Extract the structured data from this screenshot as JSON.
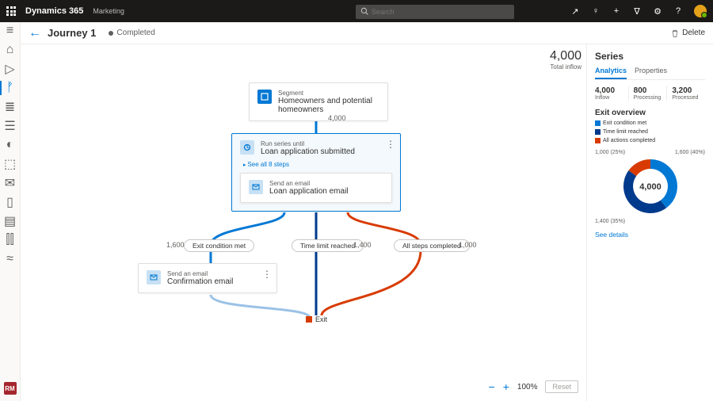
{
  "header": {
    "brand": "Dynamics 365",
    "app": "Marketing",
    "search_placeholder": "Search"
  },
  "cmdbar": {
    "title": "Journey 1",
    "status": "Completed",
    "delete": "Delete"
  },
  "canvas": {
    "total_inflow": "4,000",
    "total_inflow_label": "Total inflow",
    "segment": {
      "sub": "Segment",
      "main": "Homeowners and potential homeowners"
    },
    "count_after_segment": "4,000",
    "series": {
      "sub": "Run series until",
      "main": "Loan application submitted",
      "see_all": "See all 8 steps",
      "child": {
        "sub": "Send an email",
        "main": "Loan application email"
      }
    },
    "branches": {
      "left": {
        "label": "Exit condition met",
        "count": "1,600"
      },
      "mid": {
        "label": "Time limit reached",
        "count": "1,400"
      },
      "right": {
        "label": "All steps completed",
        "count": "1,000"
      }
    },
    "confirm": {
      "sub": "Send an email",
      "main": "Confirmation email"
    },
    "exit": "Exit",
    "zoom": "100%",
    "reset": "Reset"
  },
  "panel": {
    "title": "Series",
    "tabs": {
      "analytics": "Analytics",
      "properties": "Properties"
    },
    "stats": {
      "inflow": {
        "n": "4,000",
        "l": "Inflow"
      },
      "processing": {
        "n": "800",
        "l": "Processing"
      },
      "processed": {
        "n": "3,200",
        "l": "Processed"
      }
    },
    "overview_title": "Exit overview",
    "legend": {
      "exit": "Exit condition met",
      "time": "Time limit reached",
      "all": "All actions completed"
    },
    "donut_center": "4,000",
    "donut_labels": {
      "tl": "1,000 (25%)",
      "tr": "1,600 (40%)",
      "bl": "1,400 (35%)"
    },
    "see_details": "See details"
  },
  "leftrail_badge": "RM",
  "chart_data": {
    "type": "pie",
    "title": "Exit overview",
    "categories": [
      "Exit condition met",
      "Time limit reached",
      "All actions completed"
    ],
    "values": [
      1600,
      1400,
      1000
    ],
    "series": [
      {
        "name": "Exit condition met",
        "value": 1600,
        "color": "#0078d4"
      },
      {
        "name": "Time limit reached",
        "value": 1400,
        "color": "#003a8c"
      },
      {
        "name": "All actions completed",
        "value": 1000,
        "color": "#d83b01"
      }
    ],
    "total": 4000
  }
}
